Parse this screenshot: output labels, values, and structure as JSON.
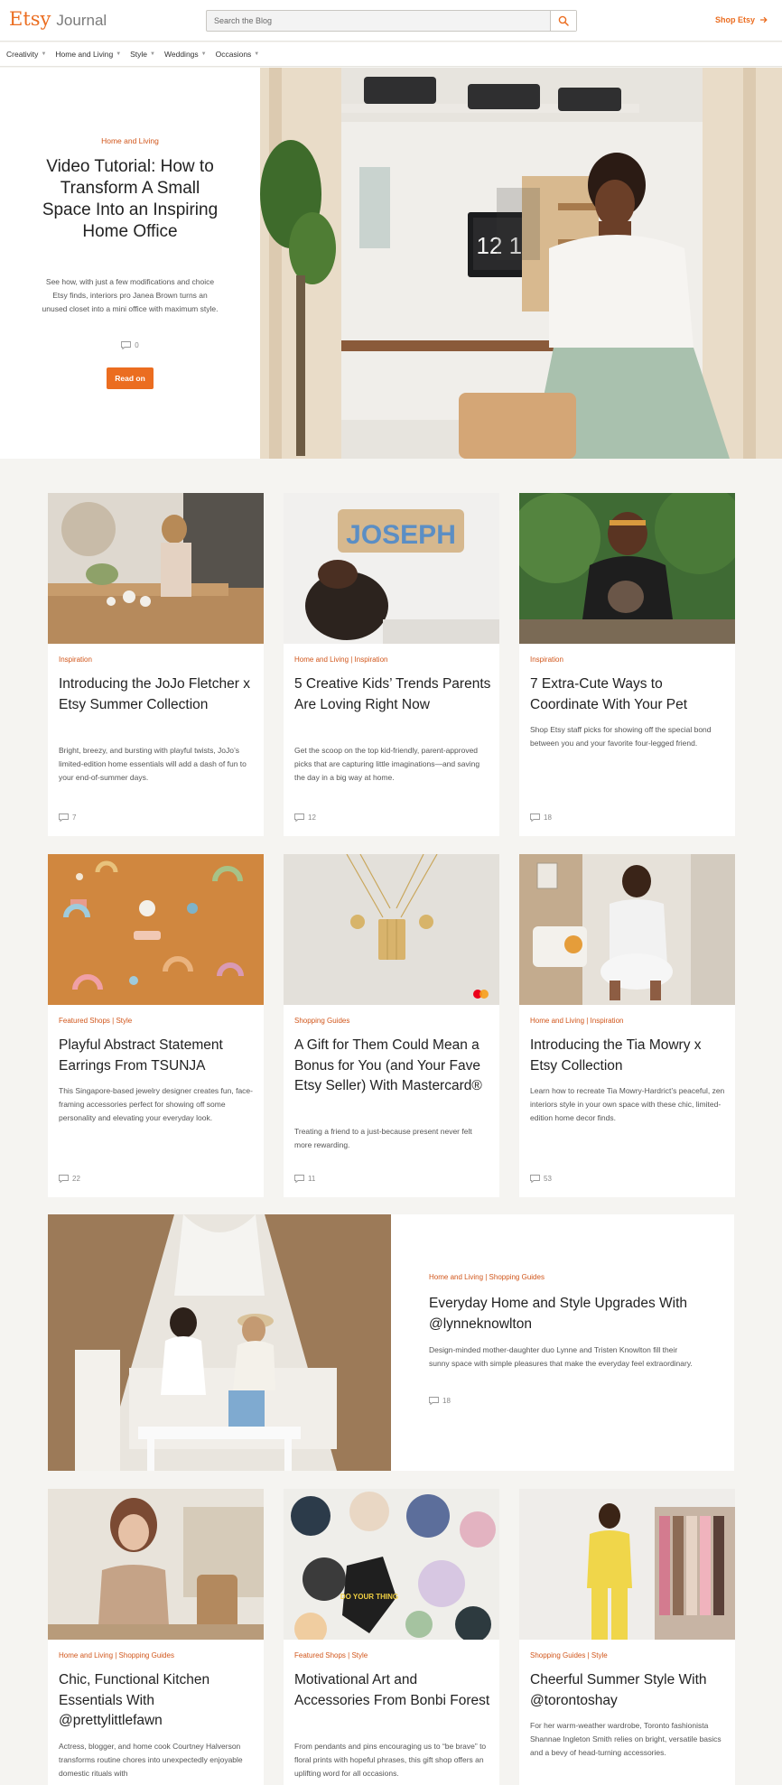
{
  "header": {
    "logo_brand": "Etsy",
    "logo_suffix": "Journal",
    "search_placeholder": "Search the Blog",
    "shop_label": "Shop Etsy",
    "accent_color": "#eb6d20"
  },
  "nav": {
    "items": [
      {
        "label": "Creativity"
      },
      {
        "label": "Home and Living"
      },
      {
        "label": "Style"
      },
      {
        "label": "Weddings"
      },
      {
        "label": "Occasions"
      }
    ]
  },
  "hero": {
    "category": "Home and Living",
    "title": "Video Tutorial: How to Transform A Small Space Into an Inspiring Home Office",
    "description": "See how, with just a few modifications and choice Etsy finds, interiors pro Janea Brown turns an unused closet into a mini office with maximum style.",
    "comments": "0",
    "button_label": "Read on",
    "clock_text": "12 10"
  },
  "cards": [
    {
      "category": "Inspiration",
      "title": "Introducing the JoJo Fletcher x Etsy Summer Collection",
      "description": "Bright, breezy, and bursting with playful twists, JoJo’s limited-edition home essentials will add a dash of fun to your end-of-summer days.",
      "comments": "7"
    },
    {
      "category": "Home and Living | Inspiration",
      "title": "5 Creative Kids’ Trends Parents Are Loving Right Now",
      "description": "Get the scoop on the top kid-friendly, parent-approved picks that are capturing little imaginations—and saving the day in a big way at home.",
      "comments": "12",
      "puzzle_text": "JOSEPH"
    },
    {
      "category": "Inspiration",
      "title": "7 Extra-Cute Ways to Coordinate With Your Pet",
      "description": "Shop Etsy staff picks for showing off the special bond between you and your favorite four-legged friend.",
      "comments": "18"
    },
    {
      "category": "Featured Shops | Style",
      "title": "Playful Abstract Statement Earrings From TSUNJA",
      "description": "This Singapore-based jewelry designer creates fun, face-framing accessories perfect for showing off some personality and elevating your everyday look.",
      "comments": "22"
    },
    {
      "category": "Shopping Guides",
      "title": "A Gift for Them Could Mean a Bonus for You (and Your Fave Etsy Seller) With Mastercard®",
      "description": "Treating a friend to a just-because present never felt more rewarding.",
      "comments": "11"
    },
    {
      "category": "Home and Living | Inspiration",
      "title": "Introducing the Tia Mowry x Etsy Collection",
      "description": "Learn how to recreate Tia Mowry-Hardrict’s peaceful, zen interiors style in your own space with these chic, limited-edition home decor finds.",
      "comments": "53"
    }
  ],
  "wide_card": {
    "category": "Home and Living | Shopping Guides",
    "title": "Everyday Home and Style Upgrades With @lynneknowlton",
    "description": "Design-minded mother-daughter duo Lynne and Tristen Knowlton fill their sunny space with simple pleasures that make the everyday feel extraordinary.",
    "comments": "18"
  },
  "bottom_cards": [
    {
      "category": "Home and Living | Shopping Guides",
      "title": "Chic, Functional Kitchen Essentials With @prettylittlefawn",
      "description": "Actress, blogger, and home cook Courtney Halverson transforms routine chores into unexpectedly enjoyable domestic rituals with"
    },
    {
      "category": "Featured Shops | Style",
      "title": "Motivational Art and Accessories From Bonbi Forest",
      "description": "From pendants and pins encouraging us to “be brave” to floral prints with hopeful phrases, this gift shop offers an uplifting word for all occasions.",
      "pin_text": "DO YOUR THING"
    },
    {
      "category": "Shopping Guides | Style",
      "title": "Cheerful Summer Style With @torontoshay",
      "description": "For her warm-weather wardrobe, Toronto fashionista Shannae Ingleton Smith relies on bright, versatile basics and a bevy of head-turning accessories."
    }
  ]
}
